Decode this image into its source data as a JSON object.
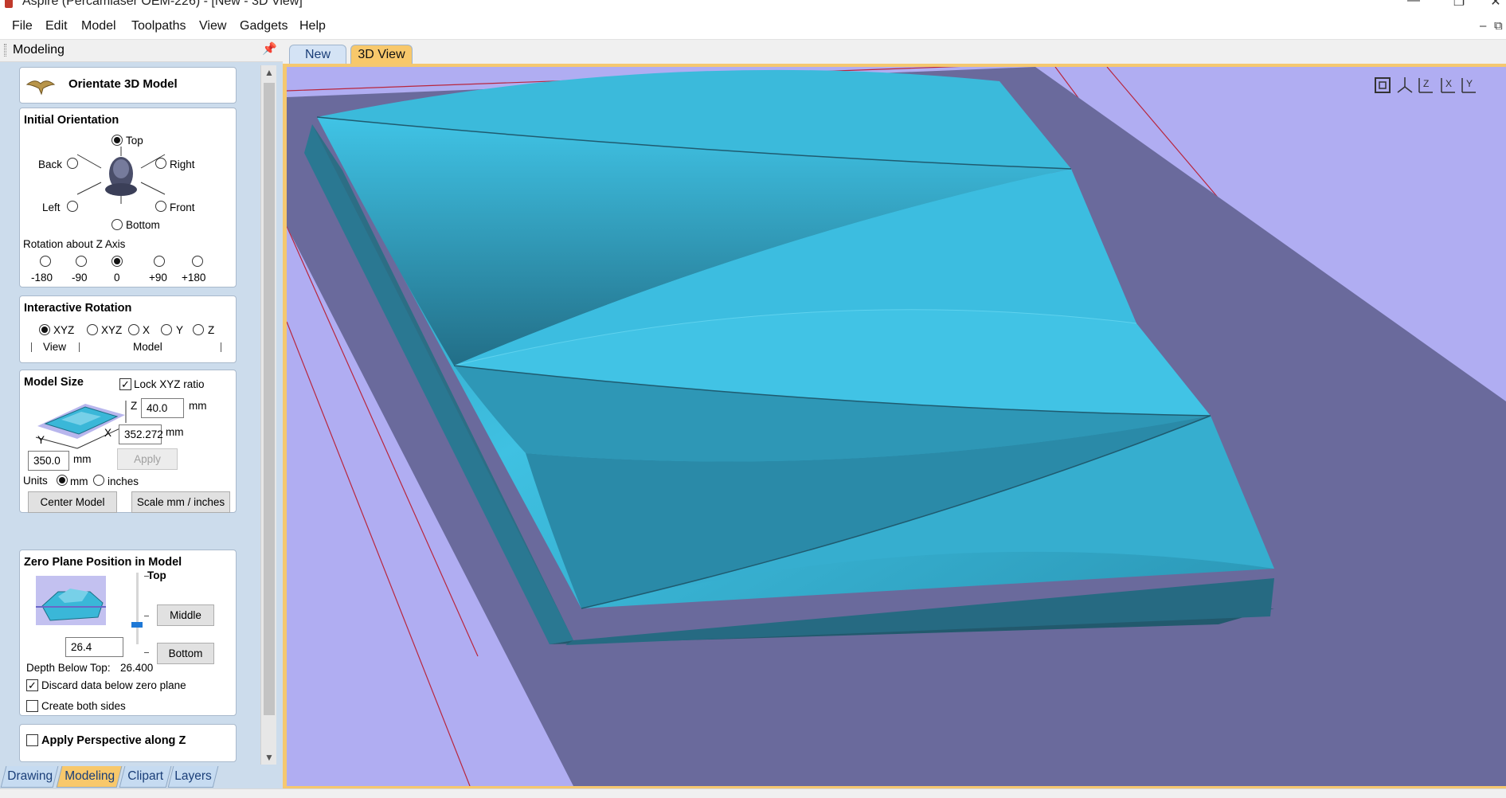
{
  "window": {
    "title": "Aspire (Percamlaser OEM-226) - [New - 3D View]",
    "controls": [
      "minimize-icon",
      "maximize-icon",
      "close-icon"
    ]
  },
  "menu": {
    "items": [
      "File",
      "Edit",
      "Model",
      "Toolpaths",
      "View",
      "Gadgets",
      "Help"
    ]
  },
  "panel": {
    "title": "Modeling",
    "orientate": {
      "label": "Orientate 3D Model"
    },
    "initial_orientation": {
      "title": "Initial Orientation",
      "top": "Top",
      "back": "Back",
      "right": "Right",
      "left": "Left",
      "front": "Front",
      "bottom": "Bottom",
      "selected": "Top",
      "rotation_title": "Rotation about Z Axis",
      "rotations": [
        "-180",
        "-90",
        "0",
        "+90",
        "+180"
      ],
      "rotation_selected": "0"
    },
    "interactive_rotation": {
      "title": "Interactive Rotation",
      "options": [
        "XYZ",
        "XYZ",
        "X",
        "Y",
        "Z"
      ],
      "selected_index": 0,
      "view_label": "View",
      "model_label": "Model"
    },
    "model_size": {
      "title": "Model Size",
      "lock_label": "Lock XYZ ratio",
      "lock_checked": true,
      "z_label": "Z",
      "z_value": "40.0",
      "x_label": "X",
      "x_value": "352.272",
      "y_label": "Y",
      "y_value": "350.0",
      "unit": "mm",
      "apply": "Apply",
      "units_label": "Units",
      "unit_mm": "mm",
      "unit_inches": "inches",
      "units_selected": "mm",
      "center_model": "Center Model",
      "scale": "Scale mm / inches"
    },
    "zero_plane": {
      "title": "Zero Plane Position in Model",
      "top": "Top",
      "middle": "Middle",
      "bottom": "Bottom",
      "value": "26.4",
      "depth_label": "Depth Below Top:",
      "depth_value": "26.400",
      "discard_label": "Discard data below zero plane",
      "discard_checked": true,
      "both_sides_label": "Create both sides",
      "both_sides_checked": false
    },
    "perspective": {
      "label": "Apply Perspective along Z",
      "checked": false
    }
  },
  "bottom_tabs": [
    "Drawing",
    "Modeling",
    "Clipart",
    "Layers"
  ],
  "bottom_tab_active": "Modeling",
  "doc_tabs": [
    "New",
    "3D View"
  ],
  "doc_tab_active": "3D View",
  "view_icons": [
    "zoom-fit-icon",
    "iso-view-icon",
    "view-z-icon",
    "view-x-icon",
    "view-y-icon"
  ],
  "colors": {
    "panel_bg": "#ccdcec",
    "active_tab": "#f8c86b",
    "viewport_bg": "#b0adf2",
    "model_cyan": "#3ab7d8"
  }
}
